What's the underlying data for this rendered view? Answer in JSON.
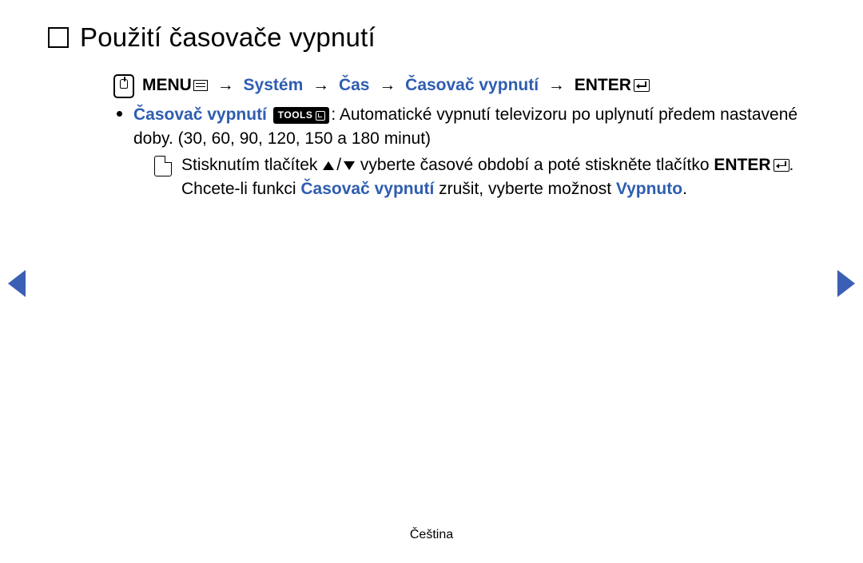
{
  "title": "Použití časovače vypnutí",
  "breadcrumb": {
    "menu_label": "MENU",
    "arrow": "→",
    "system": "Systém",
    "cas": "Čas",
    "casovac": "Časovač vypnutí",
    "enter_label": "ENTER"
  },
  "bullet": {
    "heading": "Časovač vypnutí",
    "tools_label": "TOOLS",
    "desc_1": ": Automatické vypnutí televizoru po uplynutí předem nastavené doby. (30, 60, 90, 120, 150 a 180 minut)"
  },
  "note": {
    "part1": "Stisknutím tlačítek ",
    "slash": "/",
    "part2": " vyberte časové období a poté stiskněte tlačítko ",
    "enter": "ENTER",
    "part3": ". Chcete-li funkci ",
    "casovac": "Časovač vypnutí",
    "part4": " zrušit, vyberte možnost ",
    "vypnuto": "Vypnuto",
    "part5": "."
  },
  "footer": "Čeština"
}
